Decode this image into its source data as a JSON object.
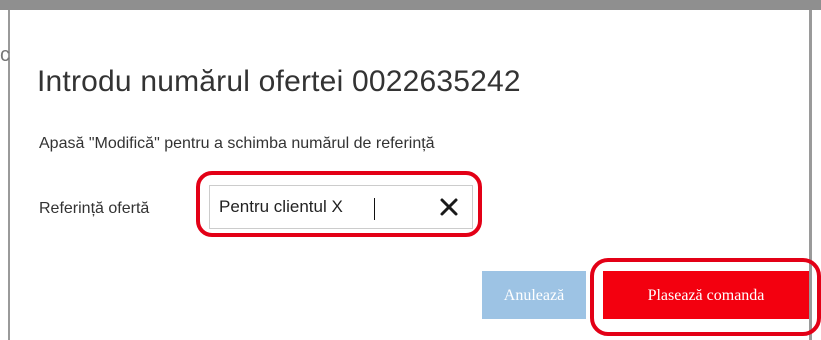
{
  "dialog": {
    "title": "Introdu numărul ofertei 0022635242",
    "hint": "Apasă \"Modifică\" pentru a schimba numărul de referință"
  },
  "form": {
    "reference_label": "Referință ofertă",
    "reference_value": "Pentru clientul X"
  },
  "buttons": {
    "cancel_label": "Anulează",
    "place_order_label": "Plasează comanda"
  },
  "background": {
    "side_glyph": "c"
  },
  "colors": {
    "highlight": "#e30016",
    "primary_button": "#f3000f",
    "cancel_button": "#9dc3e4",
    "frame": "#8f8f8f"
  },
  "icons": {
    "clear": "close-icon"
  }
}
